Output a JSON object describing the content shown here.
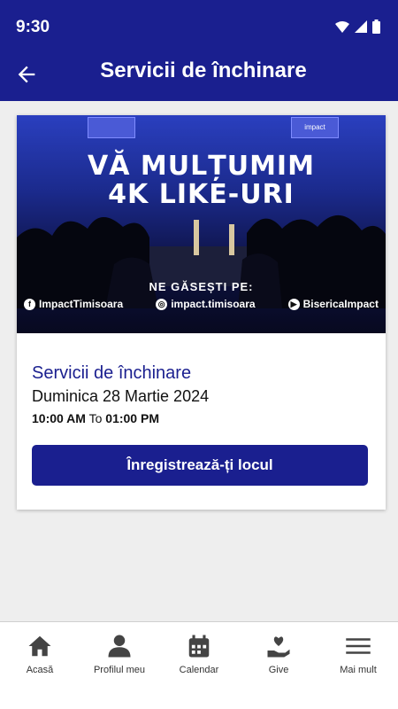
{
  "status": {
    "time": "9:30"
  },
  "header": {
    "title": "Servicii de închinare"
  },
  "banner": {
    "line1": "VĂ MULȚUMIM",
    "line2": "4K LIKE-URI",
    "find_us": "NE GĂSEȘTI PE:",
    "screen_label": "impact",
    "facebook": "ImpactTimisoara",
    "instagram": "impact.timisoara",
    "youtube": "BisericaImpact"
  },
  "event": {
    "title": "Servicii de închinare",
    "date": "Duminica 28 Martie 2024",
    "start": "10:00 AM",
    "to": "To",
    "end": "01:00 PM"
  },
  "register_label": "Înregistrează-ți locul",
  "nav": {
    "home": "Acasă",
    "profile": "Profilul meu",
    "calendar": "Calendar",
    "give": "Give",
    "more": "Mai mult"
  },
  "colors": {
    "primary": "#1a1f8f"
  }
}
